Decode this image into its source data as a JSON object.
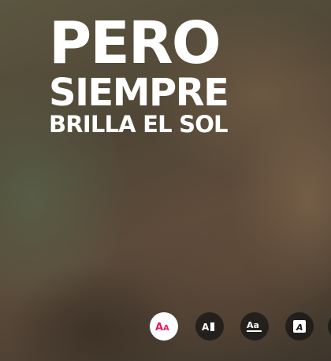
{
  "overlay": {
    "line1": "PERO",
    "line2": "SIEMPRE",
    "line3": "BRILLA EL SOL"
  },
  "toolbar": {
    "styles": [
      {
        "icon": "text-style-aa-icon",
        "label": "Aa",
        "selected": true
      },
      {
        "icon": "text-background-icon",
        "label": "A",
        "selected": false
      },
      {
        "icon": "text-underline-icon",
        "label": "Aa",
        "selected": false
      },
      {
        "icon": "text-box-icon",
        "label": "A",
        "selected": false
      }
    ],
    "colors": {
      "selected_accent": "#e8175d",
      "button_dark": "#141414",
      "icon_light": "#ffffff"
    }
  }
}
